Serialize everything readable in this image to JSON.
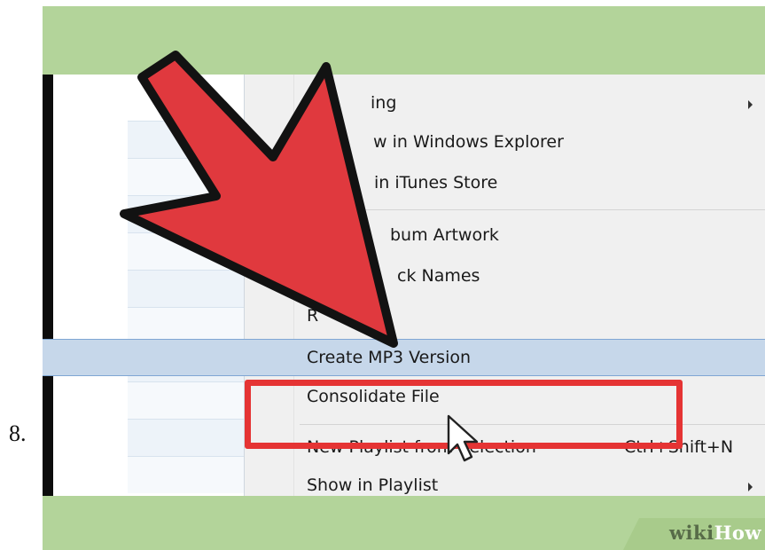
{
  "step": {
    "number": "8."
  },
  "context_menu": {
    "items": [
      {
        "id": "converting",
        "label": "...ing",
        "has_submenu": true
      },
      {
        "id": "show-explorer",
        "label": "...w in Windows Explorer"
      },
      {
        "id": "show-itunes-store",
        "label": "...in iTunes Store"
      },
      {
        "id": "album-artwork",
        "label": "...bum Artwork"
      },
      {
        "id": "track-names",
        "label": "...ck Names"
      },
      {
        "id": "reset-plays",
        "label": "R...ys"
      },
      {
        "id": "create-mp3",
        "label": "Create MP3 Version",
        "highlighted": true
      },
      {
        "id": "consolidate-files",
        "label": "Consolidate Files"
      },
      {
        "id": "new-playlist",
        "label": "New Playlist from Selection",
        "shortcut": "Ctrl+Shift+N"
      },
      {
        "id": "show-in-playlist",
        "label": "Show in Playlist",
        "has_submenu": true
      }
    ],
    "visible_text": {
      "item_0": "ing",
      "item_1": "w in Windows Explorer",
      "item_2": "in iTunes Store",
      "item_3": "bum Artwork",
      "item_4": "ck Names",
      "item_5": "R",
      "item_6": "Create MP3 Version",
      "item_7": "Consolidate File",
      "item_8": "New Playlist from Selection",
      "item_8_shortcut": "Ctrl+Shift+N",
      "item_9": "Show in Playlist"
    }
  },
  "watermark": {
    "wiki": "wiki",
    "how": "How"
  },
  "colors": {
    "frame_green": "#b3d49a",
    "menu_background": "#f0f0f0",
    "highlight_fill": "#c6d7ea",
    "highlight_border": "#7fa6d4",
    "annotation_red": "#e53434",
    "arrow_red": "#e0393e"
  },
  "icons": {
    "annotation_arrow": "big-red-arrow-icon",
    "mouse_cursor": "mouse-pointer-icon",
    "submenu_indicator": "triangle-right-icon"
  }
}
